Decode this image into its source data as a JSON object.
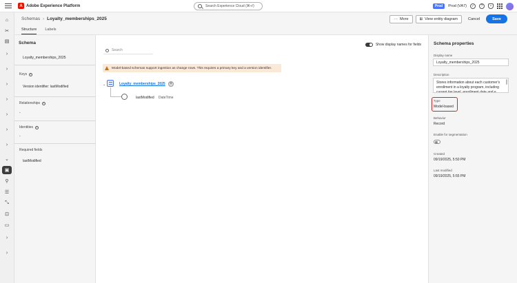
{
  "app": {
    "title": "Adobe Experience Platform",
    "logo_letter": "A"
  },
  "search": {
    "placeholder": "Search Experience Cloud (⌘+/)"
  },
  "environment": {
    "badge": "Prod",
    "name": "Prod (VA7)"
  },
  "breadcrumb": {
    "root": "Schemas",
    "current": "Loyalty_memberships_2025"
  },
  "tabs": [
    {
      "label": "Structure",
      "active": true
    },
    {
      "label": "Labels",
      "active": false
    }
  ],
  "actions": {
    "more": "More",
    "view_diagram": "View entity diagram",
    "cancel": "Cancel",
    "save": "Save"
  },
  "schema_panel": {
    "title": "Schema",
    "name": "Loyalty_memberships_2025",
    "keys_label": "Keys",
    "keys_value": "Version identifier: lastModified",
    "relationships_label": "Relationships",
    "relationships_value": "-",
    "identities_label": "Identities",
    "identities_value": "-",
    "required_label": "Required fields",
    "required_value": "lastModified"
  },
  "canvas": {
    "search_placeholder": "Search",
    "toggle_label": "Show display names for fields",
    "toggle_on": true,
    "warning": "Model-based schemas support ingestion as change rows. This requires a primary key and a version identifier.",
    "root_label": "Loyalty_memberships_2025",
    "field": {
      "name": "lastModified",
      "type": "DateTime"
    }
  },
  "properties": {
    "title": "Schema properties",
    "display_name_label": "Display name",
    "display_name_value": "Loyalty_memberships_2025",
    "description_label": "Description",
    "description_value": "Stores information about each customer's enrollment in a loyalty program, including current tier level, enrollment date and e...",
    "type_label": "Type",
    "type_value": "Model-based",
    "behavior_label": "Behavior",
    "behavior_value": "Record",
    "segmentation_label": "Enable for segmentation",
    "segmentation_enabled": false,
    "created_label": "Created",
    "created_value": "09/19/2025, 5:50 PM",
    "modified_label": "Last modified",
    "modified_value": "09/19/2025, 5:55 PM"
  },
  "colors": {
    "accent": "#1473e6",
    "highlight": "#e02020",
    "warning_bg": "#fbe9d8"
  }
}
